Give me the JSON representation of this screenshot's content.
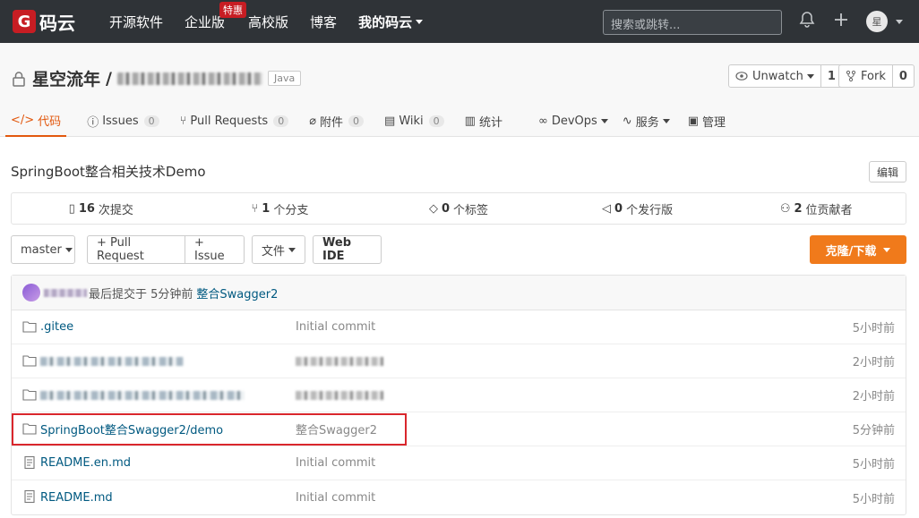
{
  "topnav": {
    "logo_mark": "G",
    "logo_text": "码云",
    "items": [
      {
        "label": "开源软件"
      },
      {
        "label": "企业版",
        "badge": "特惠"
      },
      {
        "label": "高校版"
      },
      {
        "label": "博客"
      },
      {
        "label": "我的码云"
      }
    ],
    "search_placeholder": "搜索或跳转...",
    "avatar_initial": "星"
  },
  "repo": {
    "owner": "星空流年",
    "separator": "/",
    "language": "Java",
    "watch": {
      "label": "Unwatch",
      "count": "1"
    },
    "fork": {
      "label": "Fork",
      "count": "0"
    }
  },
  "tabs": [
    {
      "label": "代码",
      "icon": "code-icon",
      "active": true
    },
    {
      "label": "Issues",
      "icon": "issue-icon",
      "count": "0"
    },
    {
      "label": "Pull Requests",
      "icon": "pull-request-icon",
      "count": "0"
    },
    {
      "label": "附件",
      "icon": "attachment-icon",
      "count": "0"
    },
    {
      "label": "Wiki",
      "icon": "wiki-icon",
      "count": "0"
    },
    {
      "label": "统计",
      "icon": "chart-icon"
    },
    {
      "label": "DevOps",
      "icon": "devops-icon",
      "dropdown": true
    },
    {
      "label": "服务",
      "icon": "service-icon",
      "dropdown": true
    },
    {
      "label": "管理",
      "icon": "manage-icon"
    }
  ],
  "description": "SpringBoot整合相关技术Demo",
  "edit_label": "编辑",
  "stats": [
    {
      "icon": "commit-icon",
      "num": "16",
      "label": "次提交"
    },
    {
      "icon": "branch-icon",
      "num": "1",
      "label": "个分支"
    },
    {
      "icon": "tag-icon",
      "num": "0",
      "label": "个标签"
    },
    {
      "icon": "release-icon",
      "num": "0",
      "label": "个发行版"
    },
    {
      "icon": "contributors-icon",
      "num": "2",
      "label": "位贡献者"
    }
  ],
  "toolbar": {
    "branch": "master",
    "pull_request": "+ Pull Request",
    "issue": "+ Issue",
    "file": "文件",
    "web_ide": "Web IDE",
    "clone": "克隆/下载"
  },
  "last_commit": {
    "text": "最后提交于 5分钟前",
    "message": "整合Swagger2"
  },
  "files": [
    {
      "type": "folder",
      "name": ".gitee",
      "message": "Initial commit",
      "time": "5小时前"
    },
    {
      "type": "folder",
      "name": "",
      "message": "",
      "time": "2小时前"
    },
    {
      "type": "folder",
      "name": "",
      "message": "",
      "time": "2小时前"
    },
    {
      "type": "folder",
      "name": "SpringBoot整合Swagger2/demo",
      "message": "整合Swagger2",
      "time": "5分钟前"
    },
    {
      "type": "file",
      "name": "README.en.md",
      "message": "Initial commit",
      "time": "5小时前"
    },
    {
      "type": "file",
      "name": "README.md",
      "message": "Initial commit",
      "time": "5小时前"
    }
  ],
  "colors": {
    "accent": "#e2580e",
    "clone": "#f07a1b",
    "nav_bg": "#2f3337",
    "link": "#005980",
    "highlight": "#d9262c"
  }
}
